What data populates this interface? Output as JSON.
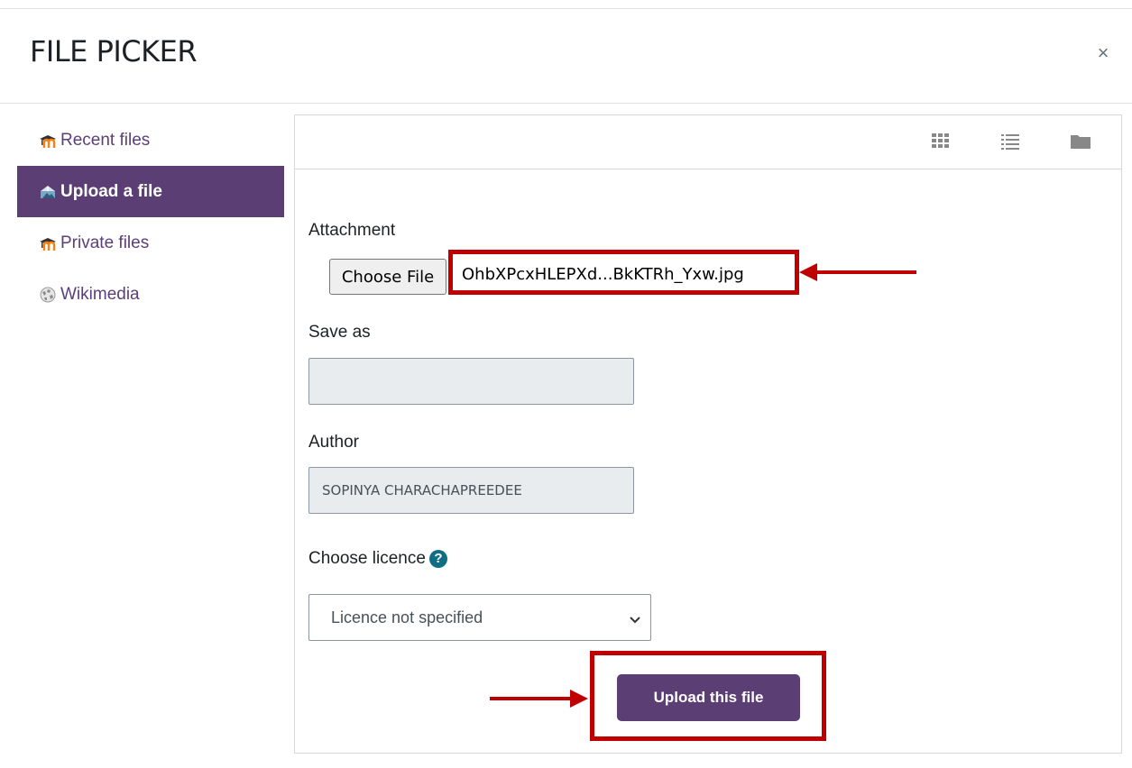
{
  "dialog": {
    "title": "FILE PICKER",
    "close_glyph": "×"
  },
  "sidebar": {
    "items": [
      {
        "label": "Recent files",
        "icon": "moodle-icon",
        "active": false
      },
      {
        "label": "Upload a file",
        "icon": "upload-icon",
        "active": true
      },
      {
        "label": "Private files",
        "icon": "moodle-icon",
        "active": false
      },
      {
        "label": "Wikimedia",
        "icon": "wikimedia-icon",
        "active": false
      }
    ]
  },
  "toolbar": {
    "views": [
      "grid-view-icon",
      "list-view-icon",
      "folder-view-icon"
    ]
  },
  "form": {
    "attachment_label": "Attachment",
    "choose_file_label": "Choose File",
    "file_name": "OhbXPcxHLEPXd...BkKTRh_Yxw.jpg",
    "save_as_label": "Save as",
    "save_as_value": "",
    "author_label": "Author",
    "author_value": "SOPINYA CHARACHAPREEDEE",
    "licence_label": "Choose licence",
    "licence_help_glyph": "?",
    "licence_value": "Licence not specified",
    "upload_button": "Upload this file"
  },
  "colors": {
    "brand": "#5b3e74",
    "annotation": "#c00000",
    "help": "#0f6e84"
  }
}
